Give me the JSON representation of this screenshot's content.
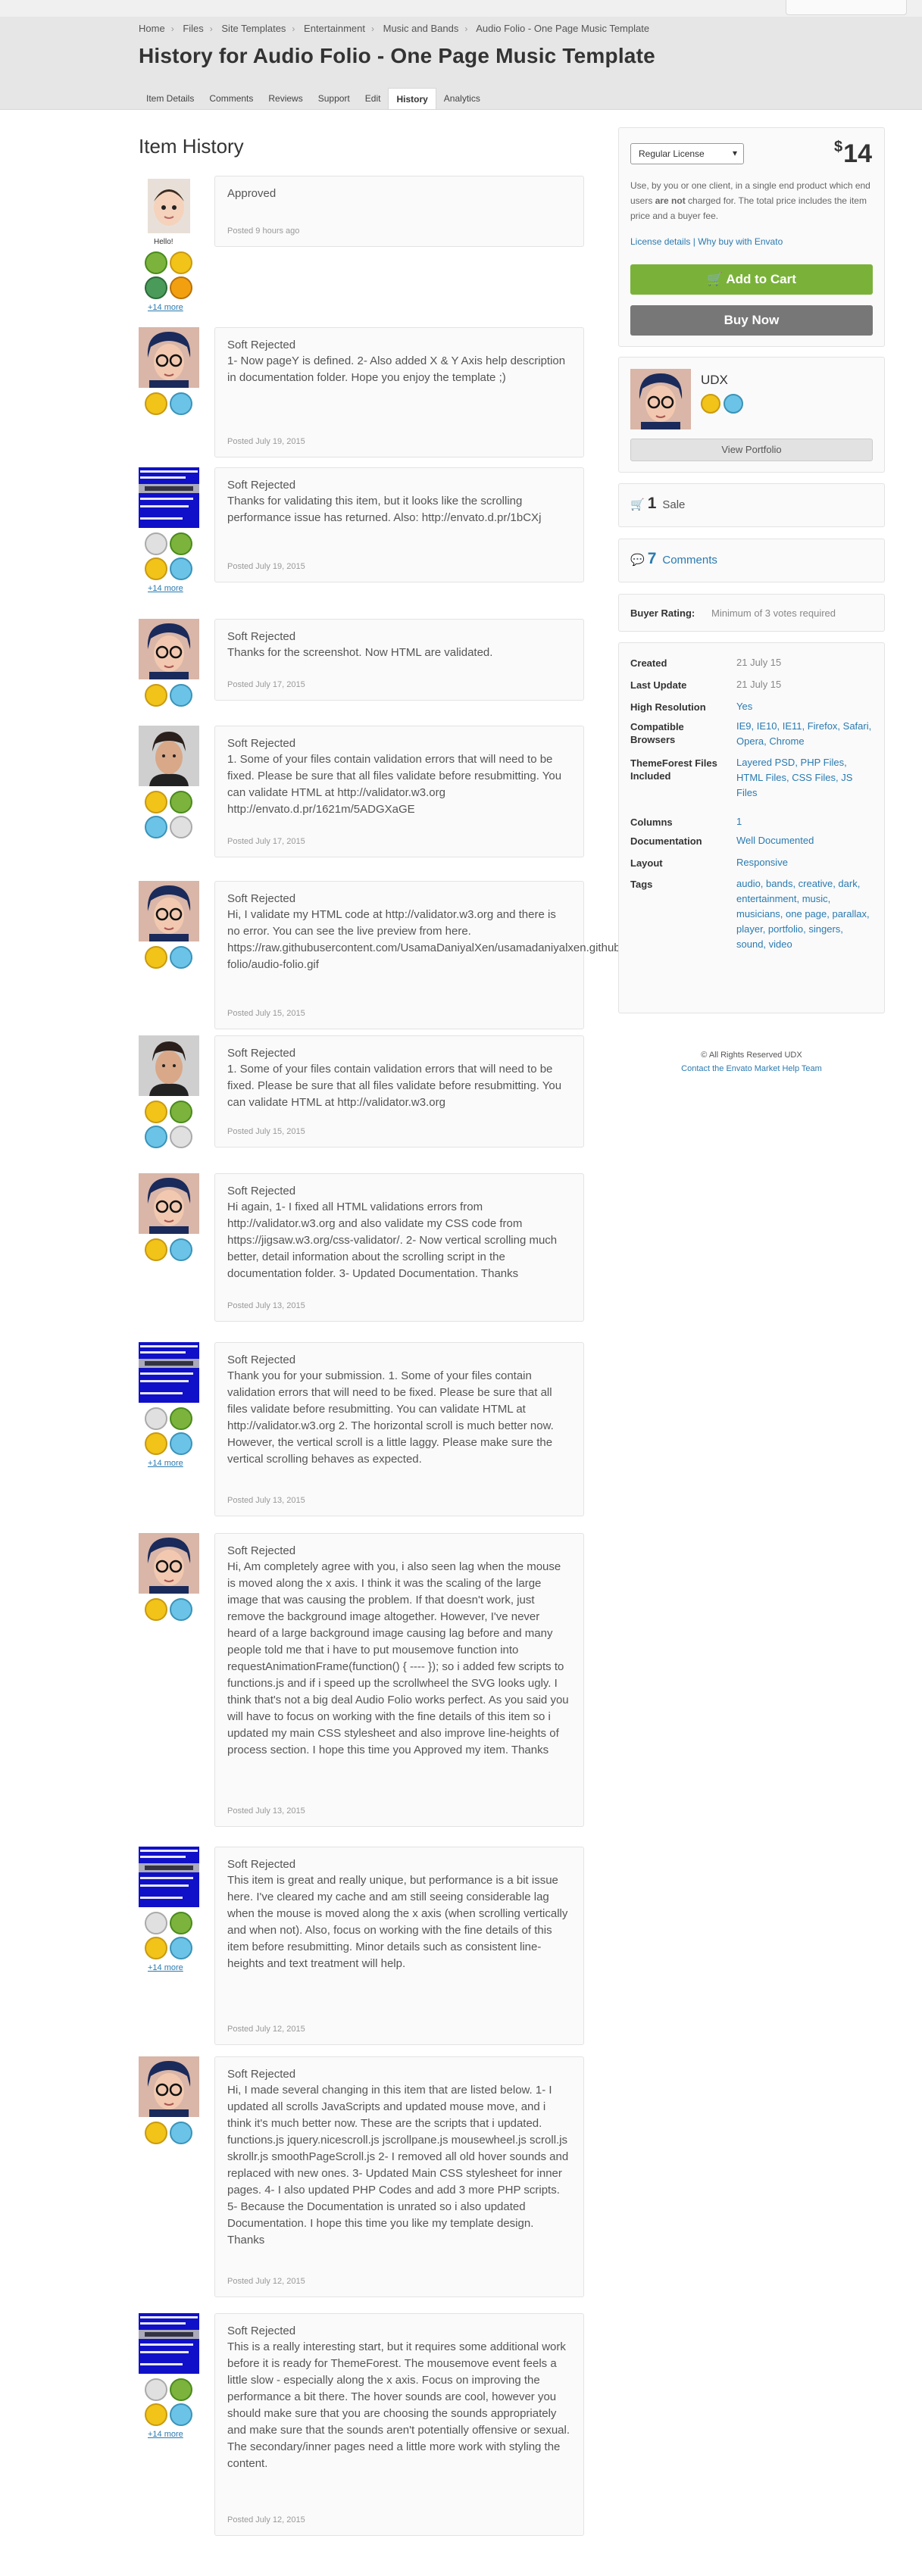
{
  "breadcrumb": [
    "Home",
    "Files",
    "Site Templates",
    "Entertainment",
    "Music and Bands",
    "Audio Folio - One Page Music Template"
  ],
  "page_title": "History for Audio Folio - One Page Music Template",
  "tabs": [
    "Item Details",
    "Comments",
    "Reviews",
    "Support",
    "Edit",
    "History",
    "Analytics"
  ],
  "active_tab": "History",
  "section_title": "Item History",
  "entries": [
    {
      "avatar": "baby",
      "show_hello": true,
      "hello": "Hello!",
      "more": "+14 more",
      "status": "Approved",
      "text": "",
      "date": "Posted 9 hours ago"
    },
    {
      "avatar": "cartoon",
      "status": "Soft Rejected",
      "text": "1- Now pageY is defined. 2- Also added X & Y Axis help description in documentation folder. Hope you enjoy the template ;)",
      "date": "Posted July 19, 2015"
    },
    {
      "avatar": "pixel",
      "more": "+14 more",
      "status": "Soft Rejected",
      "text": "Thanks for validating this item, but it looks like the scrolling performance issue has returned. Also: http://envato.d.pr/1bCXj",
      "date": "Posted July 19, 2015"
    },
    {
      "avatar": "cartoon",
      "status": "Soft Rejected",
      "text": "Thanks for the screenshot. Now HTML are validated.",
      "date": "Posted July 17, 2015"
    },
    {
      "avatar": "photo",
      "status": "Soft Rejected",
      "text": "1. Some of your files contain validation errors that will need to be fixed. Please be sure that all files validate before resubmitting. You can validate HTML at http://validator.w3.org http://envato.d.pr/1621m/5ADGXaGE",
      "date": "Posted July 17, 2015"
    },
    {
      "avatar": "cartoon",
      "status": "Soft Rejected",
      "text": "Hi, I validate my HTML code at http://validator.w3.org and there is no error. You can see the live preview from here. https://raw.githubusercontent.com/UsamaDaniyalXen/usamadaniyalxen.github.io/master/envatothemeforest/audio-folio/audio-folio.gif",
      "date": "Posted July 15, 2015"
    },
    {
      "avatar": "photo",
      "status": "Soft Rejected",
      "text": "1. Some of your files contain validation errors that will need to be fixed. Please be sure that all files validate before resubmitting. You can validate HTML at http://validator.w3.org",
      "date": "Posted July 15, 2015"
    },
    {
      "avatar": "cartoon",
      "status": "Soft Rejected",
      "text": "Hi again, 1- I fixed all HTML validations errors from http://validator.w3.org and also validate my CSS code from https://jigsaw.w3.org/css-validator/. 2- Now vertical scrolling much better, detail information about the scrolling script in the documentation folder. 3- Updated Documentation. Thanks",
      "date": "Posted July 13, 2015"
    },
    {
      "avatar": "pixel",
      "more": "+14 more",
      "status": "Soft Rejected",
      "text": "Thank you for your submission. 1. Some of your files contain validation errors that will need to be fixed. Please be sure that all files validate before resubmitting. You can validate HTML at http://validator.w3.org 2. The horizontal scroll is much better now. However, the vertical scroll is a little laggy. Please make sure the vertical scrolling behaves as expected.",
      "date": "Posted July 13, 2015"
    },
    {
      "avatar": "cartoon",
      "status": "Soft Rejected",
      "text": "Hi, Am completely agree with you, i also seen lag when the mouse is moved along the x axis. I think it was the scaling of the large image that was causing the problem. If that doesn't work, just remove the background image altogether. However, I've never heard of a large background image causing lag before and many people told me that i have to put mousemove function into requestAnimationFrame(function() { ---- }); so i added few scripts to functions.js and if i speed up the scrollwheel the SVG looks ugly. I think that's not a big deal Audio Folio works perfect. As you said you will have to focus on working with the fine details of this item so i updated my main CSS stylesheet and also improve line-heights of process section. I hope this time you Approved my item. Thanks",
      "date": "Posted July 13, 2015"
    },
    {
      "avatar": "pixel",
      "more": "+14 more",
      "status": "Soft Rejected",
      "text": "This item is great and really unique, but performance is a bit issue here. I've cleared my cache and am still seeing considerable lag when the mouse is moved along the x axis (when scrolling vertically and when not). Also, focus on working with the fine details of this item before resubmitting. Minor details such as consistent line-heights and text treatment will help.",
      "date": "Posted July 12, 2015"
    },
    {
      "avatar": "cartoon",
      "status": "Soft Rejected",
      "text": "Hi, I made several changing in this item that are listed below. 1- I updated all scrolls JavaScripts and updated mouse move, and i think it's much better now. These are the scripts that i updated. functions.js jquery.nicescroll.js jscrollpane.js mousewheel.js scroll.js skrollr.js smoothPageScroll.js 2- I removed all old hover sounds and replaced with new ones. 3- Updated Main CSS stylesheet for inner pages. 4- I also updated PHP Codes and add 3 more PHP scripts. 5- Because the Documentation is unrated so i also updated Documentation. I hope this time you like my template design. Thanks",
      "date": "Posted July 12, 2015"
    },
    {
      "avatar": "pixel",
      "more": "+14 more",
      "status": "Soft Rejected",
      "text": "This is a really interesting start, but it requires some additional work before it is ready for ThemeForest. The mousemove event feels a little slow - especially along the x axis. Focus on improving the performance a bit there. The hover sounds are cool, however you should make sure that you are choosing the sounds appropriately and make sure that the sounds aren't potentially offensive or sexual. The secondary/inner pages need a little more work with styling the content.",
      "date": "Posted July 12, 2015"
    }
  ],
  "sidebar": {
    "license": "Regular License",
    "currency": "$",
    "price": "14",
    "license_text_1": "Use, by you or one client, in a single end product which end users ",
    "license_text_bold": "are not",
    "license_text_2": " charged for. The total price includes the item price and a buyer fee.",
    "license_details": "License details",
    "link_sep": " | ",
    "why_envato": "Why buy with Envato",
    "add_to_cart": "Add to Cart",
    "buy_now": "Buy Now",
    "author": "UDX",
    "view_portfolio": "View Portfolio",
    "sales_count": "1",
    "sales_label": "Sale",
    "comments_count": "7",
    "comments_label": "Comments",
    "rating_label": "Buyer Rating:",
    "rating_value": "Minimum of 3 votes required",
    "attributes": [
      {
        "label": "Created",
        "value": "21 July 15",
        "grey": true
      },
      {
        "label": "Last Update",
        "value": "21 July 15",
        "grey": true
      },
      {
        "label": "High Resolution",
        "value": "Yes"
      },
      {
        "label": "Compatible Browsers",
        "value": "IE9, IE10, IE11, Firefox, Safari, Opera, Chrome"
      },
      {
        "label": "ThemeForest Files Included",
        "value": "Layered PSD, PHP Files, HTML Files, CSS Files, JS Files"
      },
      {
        "label": "Columns",
        "value": "1"
      },
      {
        "label": "Documentation",
        "value": "Well Documented"
      },
      {
        "label": "Layout",
        "value": "Responsive"
      },
      {
        "label": "Tags",
        "value": "audio, bands, creative, dark, entertainment, music, musicians, one page, parallax, player, portfolio, singers, sound, video"
      }
    ],
    "copyright": "© All Rights Reserved UDX",
    "contact": "Contact the Envato Market Help Team"
  }
}
